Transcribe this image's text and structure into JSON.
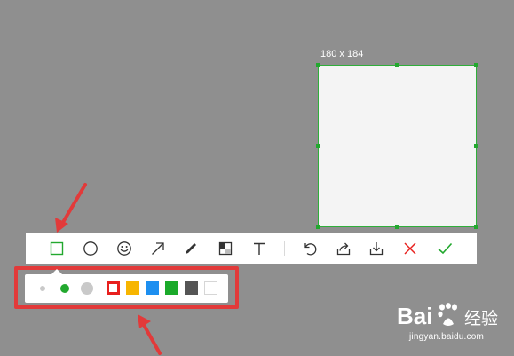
{
  "selection": {
    "size_label": "180 x 184",
    "accent_color": "#22a82e"
  },
  "toolbar": {
    "tools": [
      {
        "name": "rectangle-tool",
        "icon": "rectangle-icon"
      },
      {
        "name": "ellipse-tool",
        "icon": "circle-icon"
      },
      {
        "name": "emoji-tool",
        "icon": "smiley-icon"
      },
      {
        "name": "arrow-tool",
        "icon": "arrow-icon"
      },
      {
        "name": "pen-tool",
        "icon": "pen-icon"
      },
      {
        "name": "mosaic-tool",
        "icon": "mosaic-icon"
      },
      {
        "name": "text-tool",
        "icon": "text-icon"
      },
      {
        "name": "undo-button",
        "icon": "undo-icon"
      },
      {
        "name": "share-button",
        "icon": "share-icon"
      },
      {
        "name": "download-button",
        "icon": "download-icon"
      },
      {
        "name": "cancel-button",
        "icon": "close-icon"
      },
      {
        "name": "confirm-button",
        "icon": "check-icon"
      }
    ],
    "active_tool": "rectangle-tool"
  },
  "palette": {
    "sizes": [
      "small",
      "medium",
      "large"
    ],
    "selected_size": "medium",
    "colors": [
      "#e8201e",
      "#f7b500",
      "#1d8ff0",
      "#1aaa2a",
      "#555555",
      "#ffffff"
    ],
    "selected_color": "#e8201e"
  },
  "annotation_color": "#e23a3a",
  "watermark": {
    "brand": "Bai",
    "brand_suffix": "经验",
    "url": "jingyan.baidu.com"
  }
}
